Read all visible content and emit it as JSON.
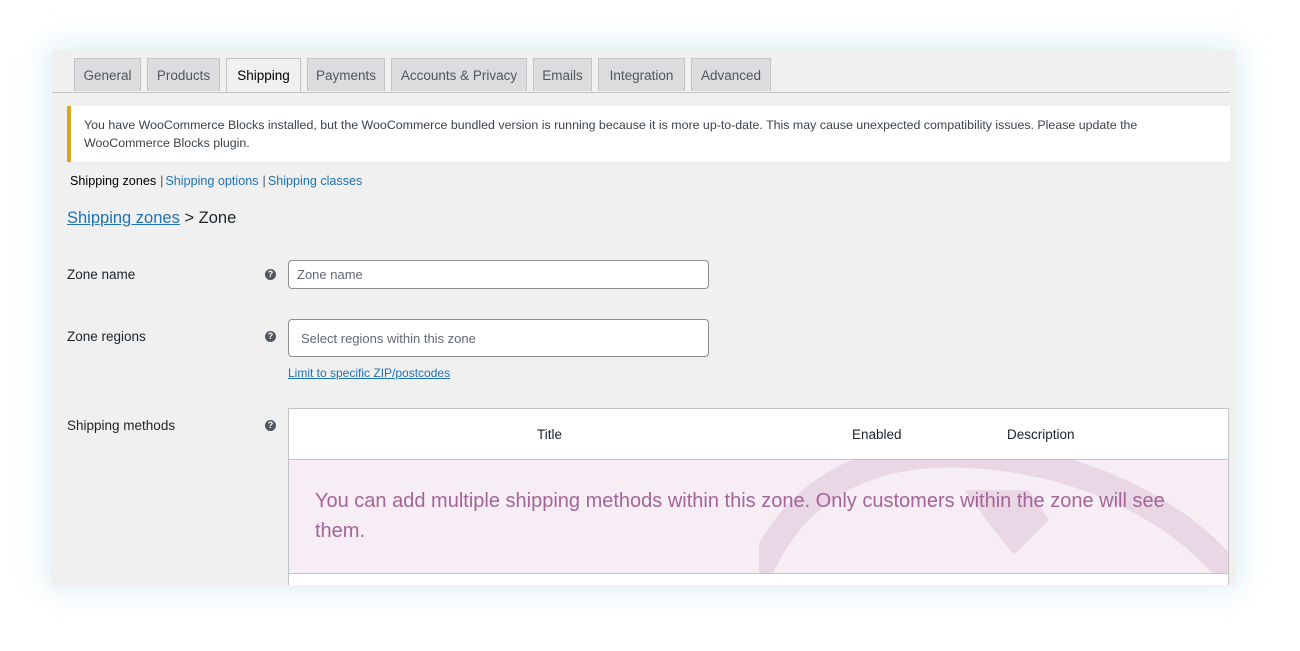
{
  "tabs": [
    {
      "label": "General",
      "active": false
    },
    {
      "label": "Products",
      "active": false
    },
    {
      "label": "Shipping",
      "active": true
    },
    {
      "label": "Payments",
      "active": false
    },
    {
      "label": "Accounts & Privacy",
      "active": false
    },
    {
      "label": "Emails",
      "active": false
    },
    {
      "label": "Integration",
      "active": false
    },
    {
      "label": "Advanced",
      "active": false
    }
  ],
  "notice": {
    "text": "You have WooCommerce Blocks installed, but the WooCommerce bundled version is running because it is more up-to-date. This may cause unexpected compatibility issues. Please update the WooCommerce Blocks plugin.",
    "accent_color": "#dba617"
  },
  "subnav": {
    "current": "Shipping zones",
    "separator": "|",
    "links": [
      "Shipping options",
      "Shipping classes"
    ]
  },
  "breadcrumb": {
    "link": "Shipping zones",
    "separator": ">",
    "current": "Zone"
  },
  "form": {
    "zone_name": {
      "label": "Zone name",
      "placeholder": "Zone name",
      "value": ""
    },
    "zone_regions": {
      "label": "Zone regions",
      "placeholder": "Select regions within this zone",
      "limit_link": "Limit to specific ZIP/postcodes"
    },
    "shipping_methods": {
      "label": "Shipping methods",
      "columns": [
        "Title",
        "Enabled",
        "Description"
      ],
      "blank_state": "You can add multiple shipping methods within this zone. Only customers within the zone will see them."
    },
    "help_icon": "?"
  },
  "colors": {
    "link": "#2271b1",
    "blank_bg": "#f7eef5",
    "blank_text": "#a46497"
  }
}
